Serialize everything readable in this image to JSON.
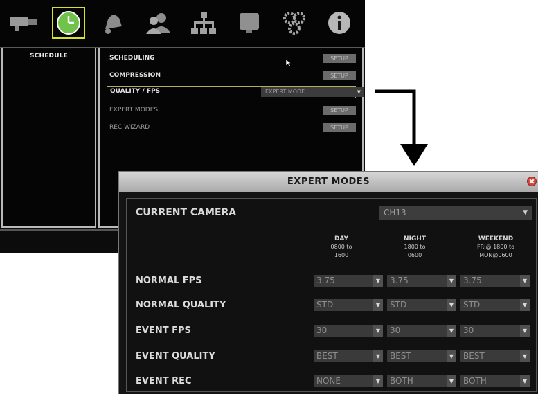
{
  "toolbar": {
    "icons": [
      "camera-icon",
      "clock-icon",
      "bell-icon",
      "users-icon",
      "network-icon",
      "monitor-icon",
      "gears-icon",
      "info-icon"
    ],
    "highlight_color": "#d7e22a"
  },
  "sidebar": {
    "title": "SCHEDULE"
  },
  "menu": {
    "items": [
      {
        "label": "SCHEDULING",
        "button": "SETUP"
      },
      {
        "label": "COMPRESSION",
        "button": "SETUP"
      },
      {
        "label": "QUALITY / FPS",
        "select": "EXPERT MODE"
      },
      {
        "label": "EXPERT MODES",
        "button": "SETUP"
      },
      {
        "label": "REC WIZARD",
        "button": "SETUP"
      }
    ]
  },
  "dialog": {
    "title": "EXPERT MODES",
    "current_camera_label": "CURRENT CAMERA",
    "current_camera_value": "CH13",
    "columns": [
      {
        "name": "DAY",
        "line1": "0800 to",
        "line2": "1600"
      },
      {
        "name": "NIGHT",
        "line1": "1800 to",
        "line2": "0600"
      },
      {
        "name": "WEEKEND",
        "line1": "FRI@ 1800 to",
        "line2": "MON@0600"
      }
    ],
    "rows": [
      {
        "label": "NORMAL FPS",
        "values": [
          "3.75",
          "3.75",
          "3.75"
        ]
      },
      {
        "label": "NORMAL QUALITY",
        "values": [
          "STD",
          "STD",
          "STD"
        ]
      },
      {
        "label": "EVENT FPS",
        "values": [
          "30",
          "30",
          "30"
        ]
      },
      {
        "label": "EVENT QUALITY",
        "values": [
          "BEST",
          "BEST",
          "BEST"
        ]
      },
      {
        "label": "EVENT REC",
        "values": [
          "NONE",
          "BOTH",
          "BOTH"
        ]
      }
    ]
  }
}
